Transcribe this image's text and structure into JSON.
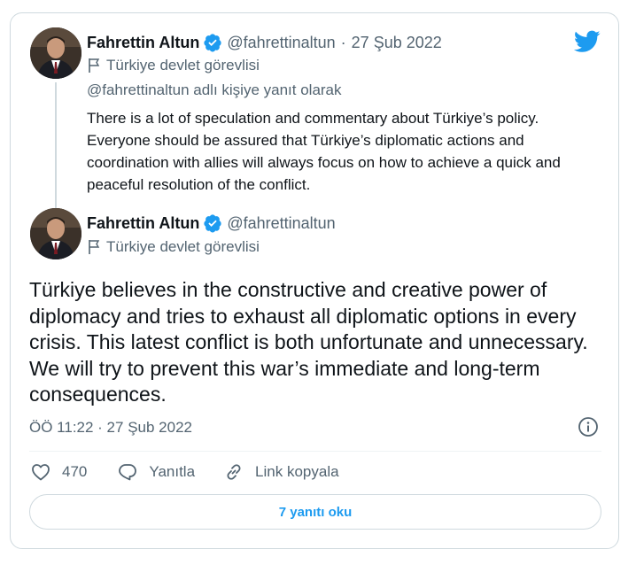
{
  "quoted_tweet": {
    "display_name": "Fahrettin Altun",
    "handle": "@fahrettinaltun",
    "separator": "·",
    "date": "27 Şub 2022",
    "account_label": "Türkiye devlet görevlisi",
    "reply_to": "@fahrettinaltun adlı kişiye yanıt olarak",
    "text": "There is a lot of speculation and commentary about Türkiye’s policy. Everyone should be assured that Türkiye’s diplomatic actions and coordination with allies will always focus on how to achieve a quick and peaceful resolution of the conflict."
  },
  "main_tweet": {
    "display_name": "Fahrettin Altun",
    "handle": "@fahrettinaltun",
    "account_label": "Türkiye devlet görevlisi",
    "text": "Türkiye believes in the constructive and creative power of diplomacy and tries to exhaust all diplomatic options in every crisis. This latest conflict is both unfortunate and unnecessary. We will try to prevent this war’s immediate and long-term consequences.",
    "timestamp": "ÖÖ 11:22 · 27 Şub 2022"
  },
  "actions": {
    "like_count": "470",
    "reply_label": "Yanıtla",
    "copy_link_label": "Link kopyala"
  },
  "read_replies_label": "7 yanıtı oku",
  "colors": {
    "brand": "#1d9bf0",
    "text_primary": "#0f1419",
    "text_secondary": "#536471",
    "border": "#cfd9de"
  },
  "icons": [
    "twitter-bird-icon",
    "verified-badge-icon",
    "flag-icon",
    "info-icon",
    "heart-icon",
    "reply-bubble-icon",
    "link-icon"
  ]
}
